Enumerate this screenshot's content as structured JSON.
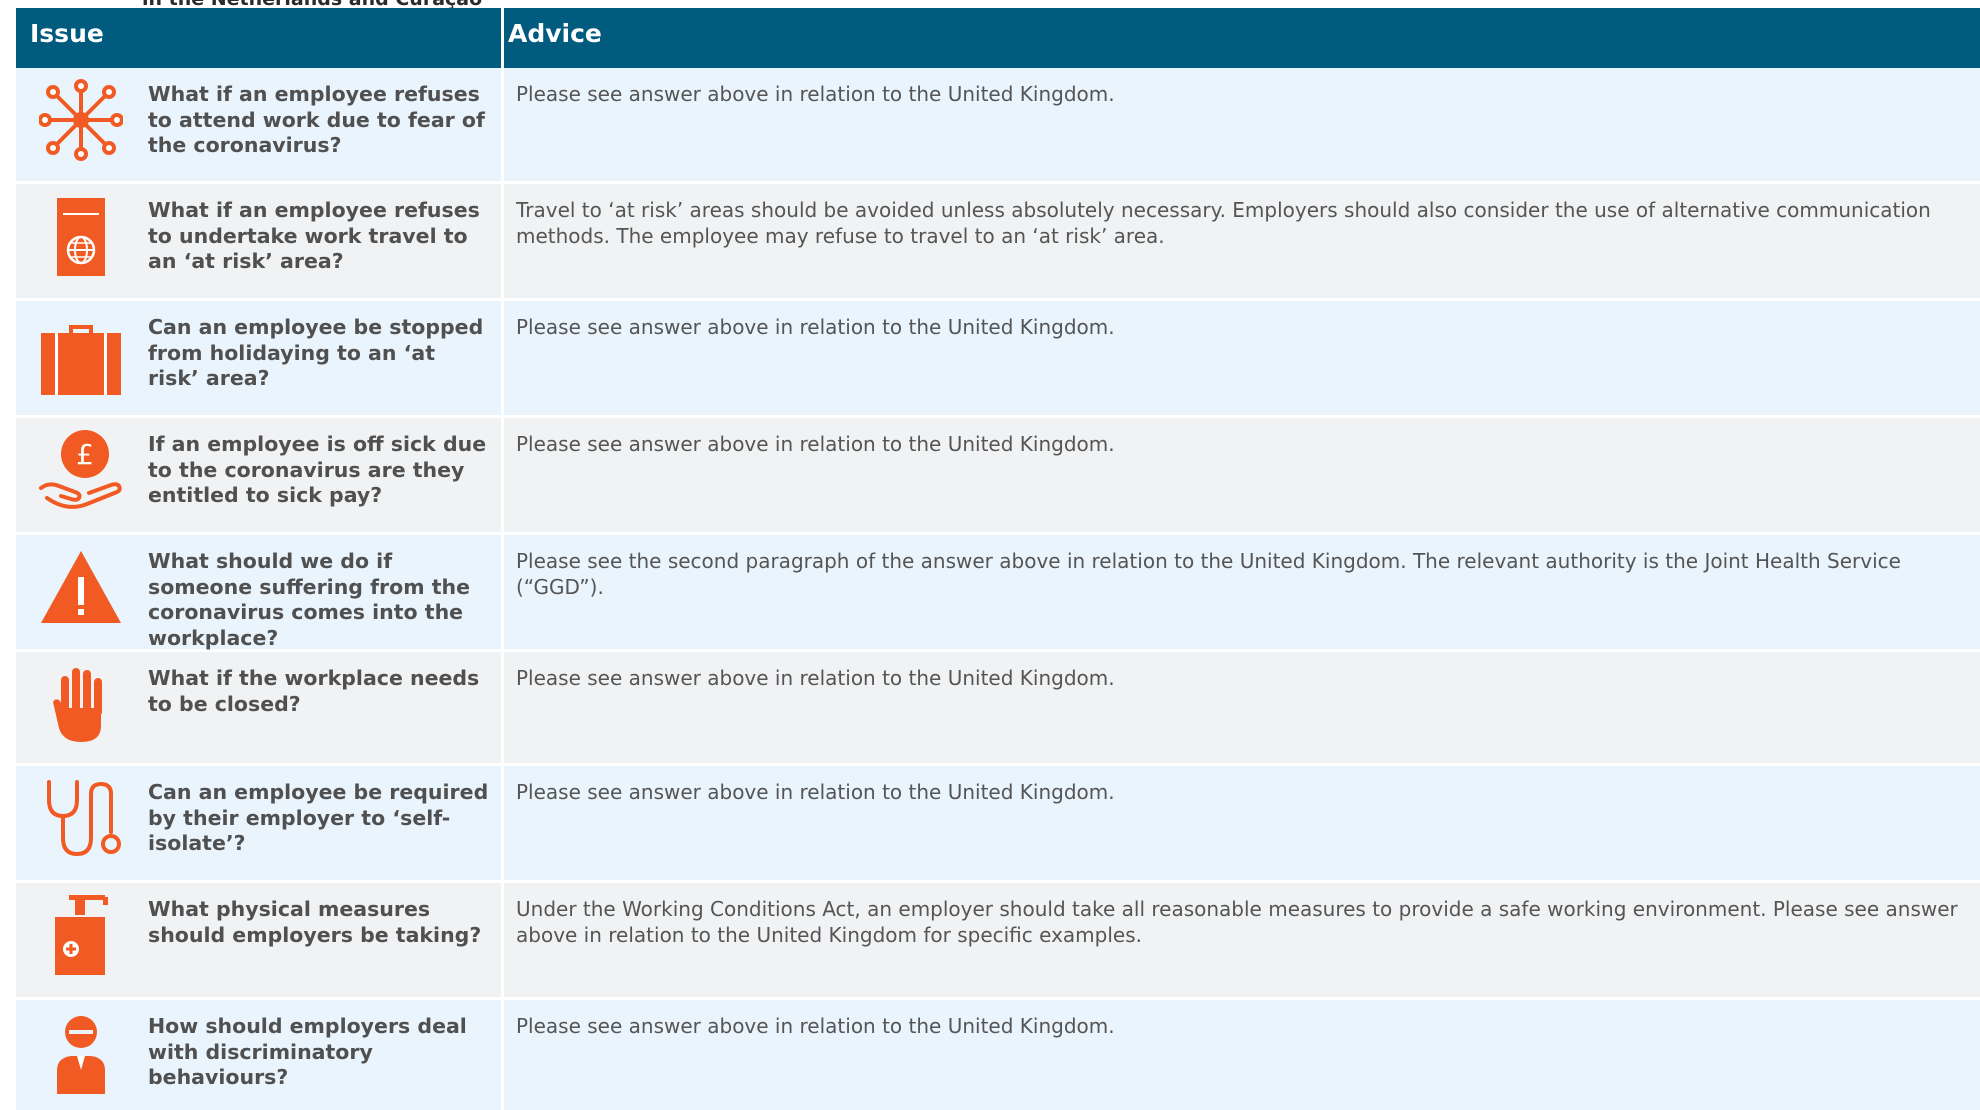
{
  "top_text": "in the Netherlands and Curaçao",
  "header": {
    "issue": "Issue",
    "advice": "Advice"
  },
  "icon_color": "#f15a22",
  "header_color": "#005b7f",
  "rows": [
    {
      "icon": "virus-molecule-icon",
      "question": "What if an employee refuses to attend work due to fear of the coronavirus?",
      "answer": "Please see answer above in relation to the United Kingdom."
    },
    {
      "icon": "passport-globe-icon",
      "question": "What if an employee refuses to undertake work travel to an ‘at risk’ area?",
      "answer": "Travel to ‘at risk’ areas should be avoided unless absolutely necessary. Employers should also consider the use of alternative communication methods. The employee may refuse to travel to an ‘at risk’ area."
    },
    {
      "icon": "suitcase-icon",
      "question": "Can an employee be stopped from holidaying to an ‘at risk’ area?",
      "answer": "Please see answer above in relation to the United Kingdom."
    },
    {
      "icon": "hand-pound-coin-icon",
      "question": "If an employee is off sick due to the coronavirus are they entitled to sick pay?",
      "answer": "Please see answer above in relation to the United Kingdom."
    },
    {
      "icon": "warning-triangle-icon",
      "question": "What should we do if someone suffering from the coronavirus comes into the workplace?",
      "answer": "Please see the second paragraph of the answer above in relation to the United Kingdom. The relevant authority is the Joint Health Service (“GGD”)."
    },
    {
      "icon": "stop-hand-icon",
      "question": "What if the workplace needs to be closed?",
      "answer": "Please see answer above in relation to the United Kingdom."
    },
    {
      "icon": "stethoscope-icon",
      "question": "Can an employee be required by their employer to ‘self-isolate’?",
      "answer": "Please see answer above in relation to the United Kingdom."
    },
    {
      "icon": "hand-sanitizer-icon",
      "question": "What physical measures should employers be taking?",
      "answer": "Under the Working Conditions Act, an employer should take all reasonable measures to provide a safe working environment. Please see answer above in relation to the United Kingdom for specific examples."
    },
    {
      "icon": "person-icon",
      "question": "How should employers deal with discriminatory behaviours?",
      "answer": "Please see answer above in relation to the United Kingdom."
    }
  ]
}
